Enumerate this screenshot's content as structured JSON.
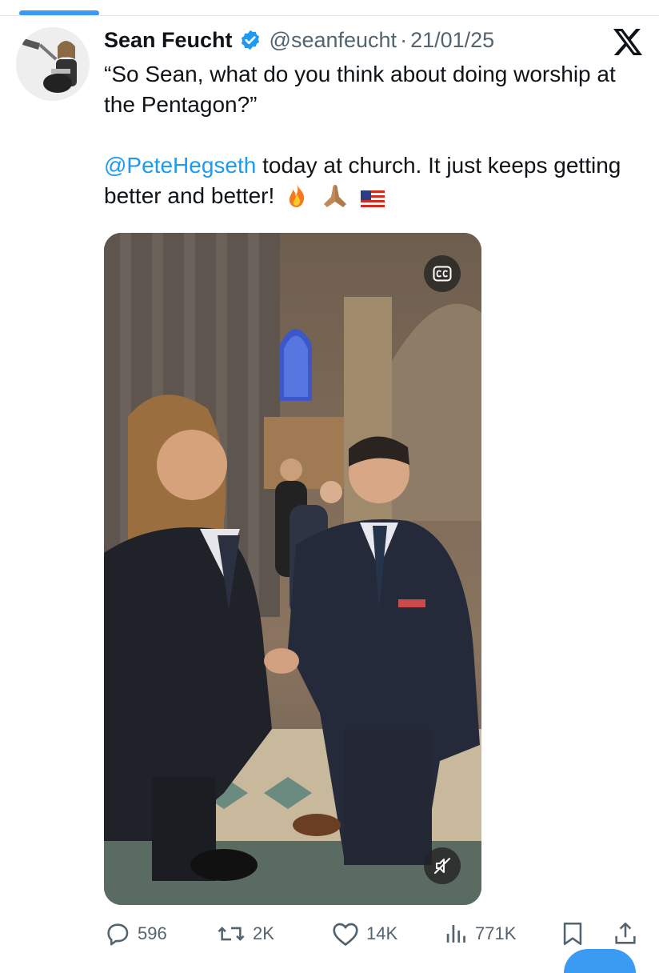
{
  "tweet": {
    "author_name": "Sean Feucht",
    "handle": "@seanfeucht",
    "separator": "·",
    "date": "21/01/25",
    "text_line1": "“So Sean, what do you think about doing worship at the Pentagon?”",
    "mention": "@PeteHegseth",
    "text_line2": " today at church. It just keeps getting better and better!",
    "emojis": [
      "fire",
      "folded-hands",
      "us-flag"
    ]
  },
  "media": {
    "type": "video",
    "cc_icon": "closed-captions-icon",
    "mute_icon": "muted-speaker-icon"
  },
  "actions": {
    "replies": "596",
    "reposts": "2K",
    "likes": "14K",
    "views": "771K"
  },
  "colors": {
    "accent": "#1d9bf0",
    "text": "#0f1419",
    "muted": "#536471"
  }
}
